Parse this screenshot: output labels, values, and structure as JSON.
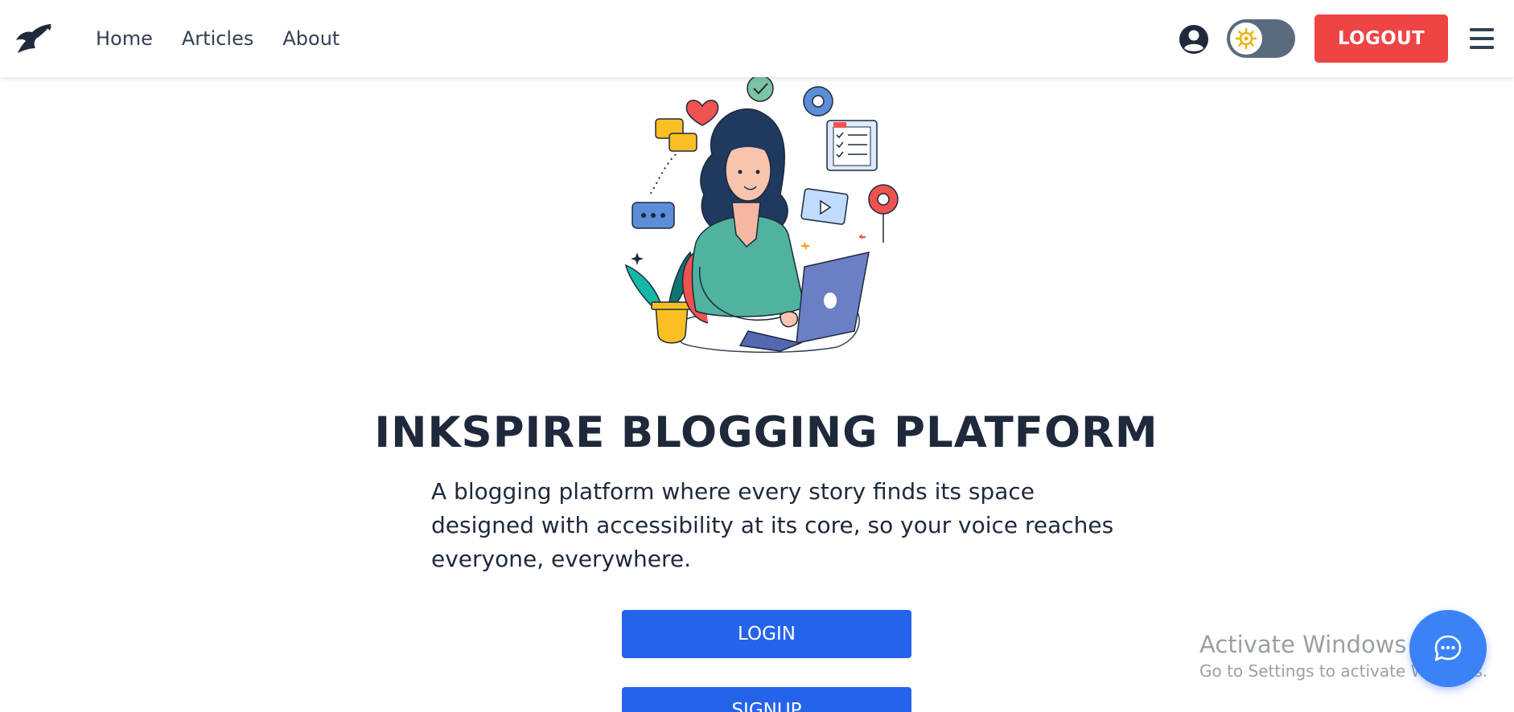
{
  "nav": {
    "logo_icon": "bird-logo-icon",
    "links": [
      "Home",
      "Articles",
      "About"
    ],
    "profile_icon": "user-circle-icon",
    "theme_toggle_icon": "sun-gear-icon",
    "logout_label": "LOGOUT",
    "menu_icon": "hamburger-menu-icon"
  },
  "hero": {
    "illustration": "woman-blogging-laptop-illustration",
    "title": "INKSPIRE BLOGGING PLATFORM",
    "description": "A blogging platform where every story finds its space designed with accessibility at its core, so your voice reaches everyone, everywhere.",
    "login_label": "LOGIN",
    "signup_label": "SIGNUP"
  },
  "watermark": {
    "title": "Activate Windows",
    "subtitle": "Go to Settings to activate Windows."
  },
  "chat": {
    "icon": "chat-bubble-icon"
  },
  "colors": {
    "logout": "#ef4444",
    "primary": "#2563eb",
    "chat": "#3b82f6",
    "toggle": "#5b6b7f",
    "title": "#1e293b"
  }
}
